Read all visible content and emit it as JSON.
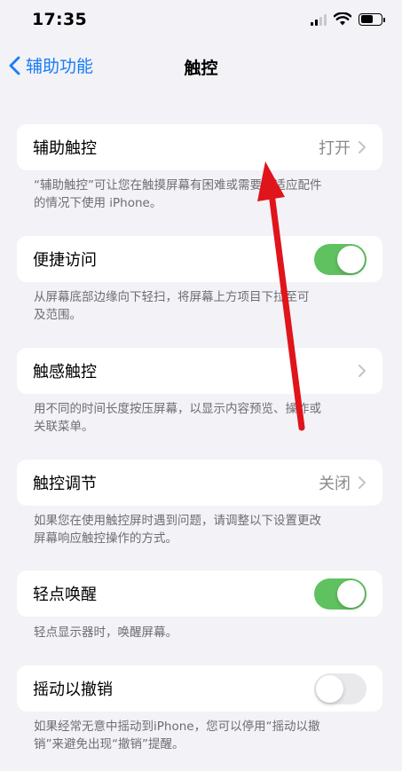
{
  "status_bar": {
    "time": "17:35"
  },
  "nav": {
    "back_label": "辅助功能",
    "title": "触控"
  },
  "settings": [
    {
      "label": "辅助触控",
      "value": "打开",
      "control": "chevron",
      "footer": [
        "“辅助触控”可让您在触摸屏幕有困难或需要自适应配件",
        "的情况下使用 iPhone。"
      ]
    },
    {
      "label": "便捷访问",
      "control": "toggle",
      "state": "on",
      "footer": [
        "从屏幕底部边缘向下轻扫，将屏幕上方项目下拉至可",
        "及范围。"
      ]
    },
    {
      "label": "触感触控",
      "control": "chevron",
      "footer": [
        "用不同的时间长度按压屏幕，以显示内容预览、操作或",
        "关联菜单。"
      ]
    },
    {
      "label": "触控调节",
      "value": "关闭",
      "control": "chevron",
      "footer": [
        "如果您在使用触控屏时遇到问题，请调整以下设置更改",
        "屏幕响应触控操作的方式。"
      ]
    },
    {
      "label": "轻点唤醒",
      "control": "toggle",
      "state": "on",
      "footer": [
        "轻点显示器时，唤醒屏幕。"
      ]
    },
    {
      "label": "摇动以撤销",
      "control": "toggle",
      "state": "off",
      "footer": [
        "如果经常无意中摇动到iPhone，您可以停用“摇动以撤",
        "销”来避免出现“撤销”提醒。"
      ]
    }
  ],
  "colors": {
    "accent": "#1a7cf5",
    "toggle_on": "#5fc15f",
    "background": "#f2f2f7",
    "annotation": "#e0141b"
  },
  "icons": [
    "chevron-left-icon",
    "chevron-right-icon",
    "cellular-signal-icon",
    "wifi-icon",
    "battery-icon",
    "red-arrow-annotation"
  ]
}
